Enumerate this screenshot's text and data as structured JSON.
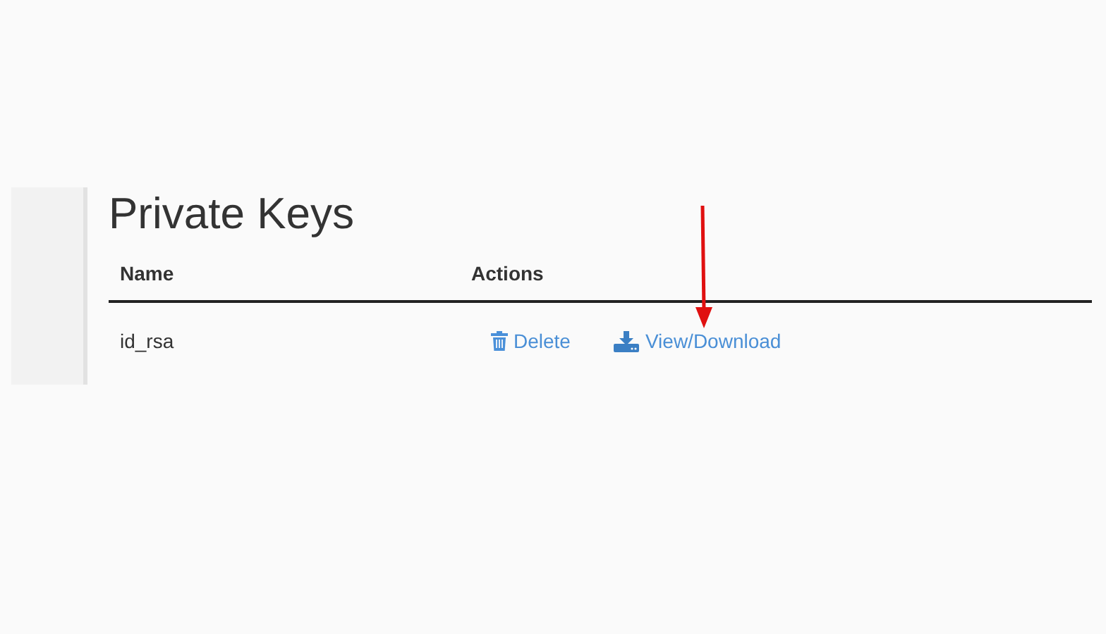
{
  "title": "Private Keys",
  "table": {
    "columns": [
      "Name",
      "Actions"
    ],
    "rows": [
      {
        "name": "id_rsa",
        "actions": [
          {
            "kind": "delete",
            "label": "Delete"
          },
          {
            "kind": "download",
            "label": "View/Download"
          }
        ]
      }
    ]
  }
}
